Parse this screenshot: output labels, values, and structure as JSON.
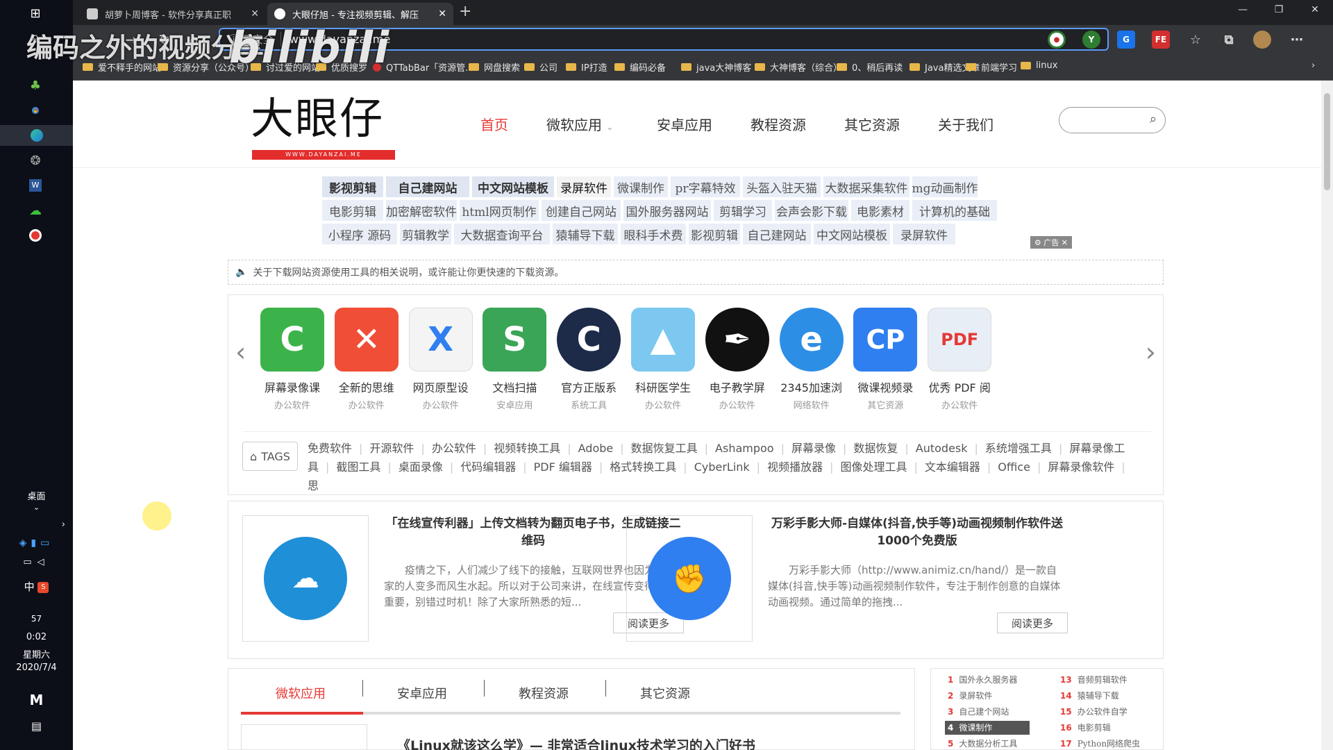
{
  "tabs": [
    {
      "title": "胡萝卜周博客 - 软件分享真正职",
      "active": false
    },
    {
      "title": "大眼仔旭 - 专注视频剪辑、解压",
      "active": true
    }
  ],
  "address": {
    "security": "不安全",
    "url": "www.dayanzai.me"
  },
  "extensions": [
    {
      "label": "Y",
      "color": "#2e7d32"
    },
    {
      "label": "G",
      "color": "#1a73e8"
    },
    {
      "label": "FE",
      "color": "#d32f2f"
    }
  ],
  "bookmarks": [
    "爱不释手的网站",
    "资源分享（公众号）",
    "讨过爱的网站",
    "优质搜罗",
    "QTTabBar「资源管...",
    "网盘搜索",
    "公司",
    "IP打造",
    "编码必备",
    "java大神博客",
    "大神博客（综合）",
    "0、稍后再读",
    "Java精选文章",
    "前端学习",
    "linux"
  ],
  "taskbar": {
    "desktop_label": "桌面",
    "ime": "中",
    "notif_count": "57",
    "time": "0:02",
    "weekday": "星期六",
    "date": "2020/7/4"
  },
  "watermark": {
    "text": "编码之外的视频分享",
    "brand": "bilibili"
  },
  "site": {
    "logo_text": "大眼仔",
    "logo_sub": "WWW.DAYANZAI.ME",
    "nav": [
      "首页",
      "微软应用",
      "安卓应用",
      "教程资源",
      "其它资源",
      "关于我们"
    ],
    "ads": [
      [
        "影视剪辑",
        "自己建网站",
        "中文网站模板",
        "录屏软件",
        "微课制作",
        "pr字幕特效",
        "头盔入驻天猫",
        "大数据采集软件",
        "mg动画制作"
      ],
      [
        "电影剪辑",
        "加密解密软件",
        "html网页制作",
        "创建自己网站",
        "国外服务器网站",
        "剪辑学习",
        "会声会影下载",
        "电影素材",
        "计算机的基础"
      ],
      [
        "小程序 源码",
        "剪辑教学",
        "大数据查询平台",
        "猿辅导下载",
        "眼科手术费",
        "影视剪辑",
        "自己建网站",
        "中文网站模板",
        "录屏软件"
      ]
    ],
    "ad_label": "广告",
    "notice": "关于下载网站资源使用工具的相关说明，或许能让你更快速的下载资源。",
    "apps": [
      {
        "name": "屏幕录像课",
        "cat": "办公软件",
        "color": "#3cb34a",
        "glyph": "C"
      },
      {
        "name": "全新的思维",
        "cat": "办公软件",
        "color": "#f04e37",
        "glyph": "✕"
      },
      {
        "name": "网页原型设",
        "cat": "办公软件",
        "color": "#f4f4f4",
        "glyph": "X"
      },
      {
        "name": "文档扫描",
        "cat": "安卓应用",
        "color": "#3aa556",
        "glyph": "S"
      },
      {
        "name": "官方正版系",
        "cat": "系统工具",
        "color": "#1d2b49",
        "glyph": "C"
      },
      {
        "name": "科研医学生",
        "cat": "办公软件",
        "color": "#7cc8f0",
        "glyph": "▲"
      },
      {
        "name": "电子教学屏",
        "cat": "办公软件",
        "color": "#111111",
        "glyph": "✒"
      },
      {
        "name": "2345加速浏",
        "cat": "网络软件",
        "color": "#2d8ee6",
        "glyph": "e"
      },
      {
        "name": "微课视频录",
        "cat": "其它资源",
        "color": "#2f7ff0",
        "glyph": "CP"
      },
      {
        "name": "优秀 PDF 阅",
        "cat": "办公软件",
        "color": "#e8eef6",
        "glyph": "PDF"
      }
    ],
    "tags_label": "TAGS",
    "tags": [
      "免费软件",
      "开源软件",
      "办公软件",
      "视频转换工具",
      "Adobe",
      "数据恢复工具",
      "Ashampoo",
      "屏幕录像",
      "数据恢复",
      "Autodesk",
      "系统增强工具",
      "屏幕录像工具",
      "截图工具",
      "桌面录像",
      "代码编辑器",
      "PDF 编辑器",
      "格式转换工具",
      "CyberLink",
      "视频播放器",
      "图像处理工具",
      "文本编辑器",
      "Office",
      "屏幕录像软件",
      "思"
    ],
    "posts": [
      {
        "title": "「在线宣传利器」上传文档转为翻页电子书，生成链接二维码",
        "excerpt": "疫情之下，人们减少了线下的接触，互联网世界也因为宅在家的人变多而风生水起。所以对于公司来讲，在线宣传变得非常重要，别错过时机！除了大家所熟悉的短...",
        "more": "阅读更多",
        "color": "#1f8fd8",
        "glyph": "☁"
      },
      {
        "title": "万彩手影大师-自媒体(抖音,快手等)动画视频制作软件送1000个免费版",
        "excerpt": "万彩手影大师（http://www.animiz.cn/hand/）是一款自媒体(抖音,快手等)动画视频制作软件，专注于制作创意的自媒体动画视频。通过简单的拖拽...",
        "more": "阅读更多",
        "color": "#2f7ff0",
        "glyph": "✊"
      }
    ],
    "cat_tabs": [
      "微软应用",
      "安卓应用",
      "教程资源",
      "其它资源"
    ],
    "list_first": "《Linux就该这么学》— 非常适合linux技术学习的入门好书",
    "ranking_left": [
      {
        "n": "1",
        "t": "国外永久服务器"
      },
      {
        "n": "2",
        "t": "录屏软件"
      },
      {
        "n": "3",
        "t": "自己建个网站"
      },
      {
        "n": "4",
        "t": "微课制作"
      },
      {
        "n": "5",
        "t": "大数据分析工具"
      }
    ],
    "ranking_right": [
      {
        "n": "13",
        "t": "音频剪辑软件"
      },
      {
        "n": "14",
        "t": "猿辅导下载"
      },
      {
        "n": "15",
        "t": "办公软件自学"
      },
      {
        "n": "16",
        "t": "电影剪辑"
      },
      {
        "n": "17",
        "t": "Python网络爬虫"
      }
    ]
  }
}
